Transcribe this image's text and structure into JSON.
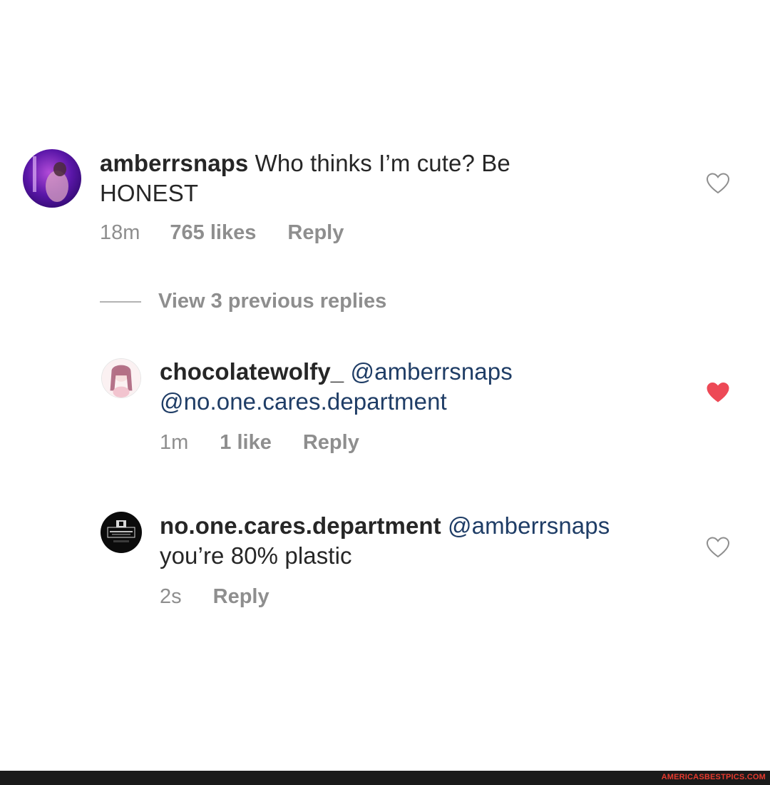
{
  "comments": [
    {
      "username": "amberrsnaps",
      "text_line1": "Who thinks I’m cute? Be",
      "text_line2": "HONEST",
      "time": "18m",
      "likes": "765 likes",
      "reply": "Reply",
      "liked": false
    },
    {
      "username": "chocolatewolfy_",
      "mention1": "@amberrsnaps",
      "mention2": "@no.one.cares.department",
      "time": "1m",
      "likes": "1 like",
      "reply": "Reply",
      "liked": true
    },
    {
      "username": "no.one.cares.department",
      "mention1": "@amberrsnaps",
      "text_line2": "you’re 80% plastic",
      "time": "2s",
      "reply": "Reply",
      "liked": false
    }
  ],
  "view_replies": "View 3 previous replies",
  "watermark": "AMERICASBESTPICS.COM",
  "icons": {
    "heart_outline": "heart-outline-icon",
    "heart_filled": "heart-filled-icon"
  },
  "colors": {
    "text": "#262626",
    "secondary": "#8e8e8e",
    "mention": "#1f3d66",
    "like_red": "#ed4956",
    "watermark": "#e63a2e"
  }
}
